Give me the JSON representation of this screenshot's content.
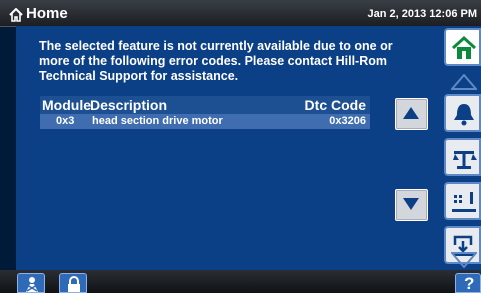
{
  "header": {
    "title": "Home",
    "datetime": "Jan 2, 2013 12:06 PM"
  },
  "message": "The selected feature is not currently available due to one or more of the following error codes.  Please contact Hill-Rom Technical Support for assistance.",
  "table": {
    "columns": [
      "Module",
      "Description",
      "Dtc Code"
    ],
    "rows": [
      {
        "module": "0x3",
        "description": "head section drive motor",
        "code": "0x3206"
      }
    ]
  },
  "icons": {
    "title": "home-icon",
    "scroll_up": "triangle-up-icon",
    "scroll_down": "triangle-down-icon",
    "nav": [
      "home-icon",
      "chevron-up-icon",
      "bell-icon",
      "scale-icon",
      "bed-icon",
      "exit-bed-icon",
      "chevron-down-icon"
    ],
    "bottom": [
      "nurse-icon",
      "lock-icon",
      "help-icon"
    ]
  },
  "help_label": "?",
  "colors": {
    "panel": "#0b3f86",
    "row": "#3f6db0",
    "accent_green": "#0a8a3a"
  }
}
